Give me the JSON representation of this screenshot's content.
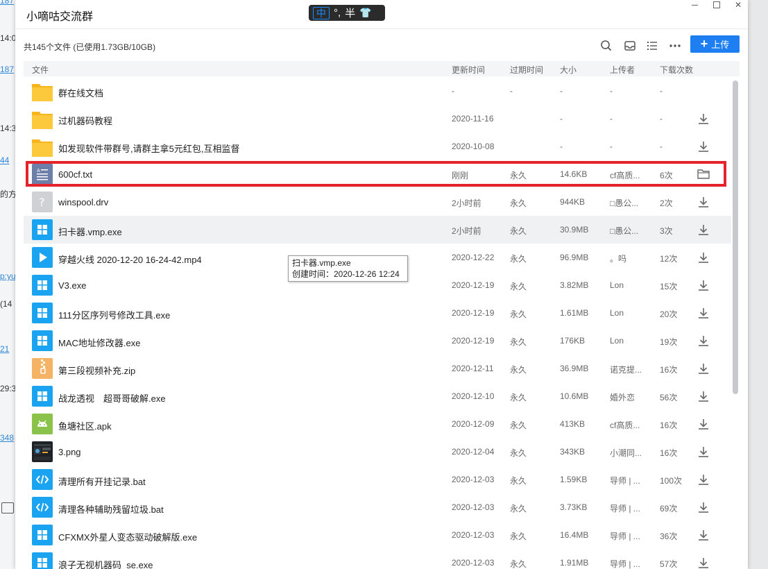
{
  "window": {
    "title": "小嘀咕交流群"
  },
  "ime": {
    "mode": "中",
    "punct": "°,",
    "width": "半"
  },
  "toolbar": {
    "summary": "共145个文件 (已使用1.73GB/10GB)",
    "upload_label": "上传"
  },
  "columns": {
    "name": "文件",
    "updated": "更新时间",
    "expiry": "过期时间",
    "size": "大小",
    "uploader": "上传者",
    "downloads": "下载次数"
  },
  "files": [
    {
      "name": "群在线文档",
      "icon": "folder-icon",
      "date": "-",
      "expiry": "-",
      "size": "-",
      "uploader": "-",
      "downloads": "-",
      "action": ""
    },
    {
      "name": "过机器码教程",
      "icon": "folder-icon",
      "date": "2020-11-16",
      "expiry": "",
      "size": "-",
      "uploader": "-",
      "downloads": "-",
      "action": "download-icon"
    },
    {
      "name": "如发现软件带群号,请群主拿5元红包,互相监督",
      "icon": "folder-icon",
      "date": "2020-10-08",
      "expiry": "",
      "size": "-",
      "uploader": "-",
      "downloads": "-",
      "action": "download-icon"
    },
    {
      "name": "600cf.txt",
      "icon": "text-file-icon",
      "date": "刚刚",
      "expiry": "永久",
      "size": "14.6KB",
      "uploader": "cf高质...",
      "downloads": "6次",
      "action": "open-folder-icon"
    },
    {
      "name": "winspool.drv",
      "icon": "unknown-file-icon",
      "date": "2小时前",
      "expiry": "永久",
      "size": "944KB",
      "uploader": "□愚公...",
      "downloads": "2次",
      "action": "download-icon"
    },
    {
      "name": "扫卡器.vmp.exe",
      "icon": "exe-icon",
      "date": "2小时前",
      "expiry": "永久",
      "size": "30.9MB",
      "uploader": "□愚公...",
      "downloads": "3次",
      "action": "download-icon"
    },
    {
      "name": "穿越火线 2020-12-20 16-24-42.mp4",
      "icon": "video-icon",
      "date": "2020-12-22",
      "expiry": "永久",
      "size": "96.9MB",
      "uploader": "。吗",
      "downloads": "12次",
      "action": "download-icon"
    },
    {
      "name": "V3.exe",
      "icon": "exe-icon",
      "date": "2020-12-19",
      "expiry": "永久",
      "size": "3.82MB",
      "uploader": "Lon",
      "downloads": "15次",
      "action": "download-icon"
    },
    {
      "name": "111分区序列号修改工具.exe",
      "icon": "exe-icon",
      "date": "2020-12-19",
      "expiry": "永久",
      "size": "1.61MB",
      "uploader": "Lon",
      "downloads": "20次",
      "action": "download-icon"
    },
    {
      "name": "MAC地址修改器.exe",
      "icon": "exe-icon",
      "date": "2020-12-19",
      "expiry": "永久",
      "size": "176KB",
      "uploader": "Lon",
      "downloads": "19次",
      "action": "download-icon"
    },
    {
      "name": "第三段视频补充.zip",
      "icon": "zip-icon",
      "date": "2020-12-11",
      "expiry": "永久",
      "size": "36.9MB",
      "uploader": "诺克提...",
      "downloads": "16次",
      "action": "download-icon"
    },
    {
      "name": "战龙透视　超哥哥破解.exe",
      "icon": "exe-icon",
      "date": "2020-12-10",
      "expiry": "永久",
      "size": "10.6MB",
      "uploader": "婚外恋",
      "downloads": "56次",
      "action": "download-icon"
    },
    {
      "name": "鱼塘社区.apk",
      "icon": "apk-icon",
      "date": "2020-12-09",
      "expiry": "永久",
      "size": "413KB",
      "uploader": "cf高质...",
      "downloads": "16次",
      "action": "download-icon"
    },
    {
      "name": "3.png",
      "icon": "image-thumbnail-icon",
      "date": "2020-12-04",
      "expiry": "永久",
      "size": "343KB",
      "uploader": "小潮同...",
      "downloads": "16次",
      "action": "download-icon"
    },
    {
      "name": "清理所有开挂记录.bat",
      "icon": "code-file-icon",
      "date": "2020-12-03",
      "expiry": "永久",
      "size": "1.59KB",
      "uploader": "导师 | ...",
      "downloads": "100次",
      "action": "download-icon"
    },
    {
      "name": "清理各种辅助残留垃圾.bat",
      "icon": "code-file-icon",
      "date": "2020-12-03",
      "expiry": "永久",
      "size": "3.73KB",
      "uploader": "导师 | ...",
      "downloads": "69次",
      "action": "download-icon"
    },
    {
      "name": "CFXMX外星人变态驱动破解版.exe",
      "icon": "exe-icon",
      "date": "2020-12-03",
      "expiry": "永久",
      "size": "16.4MB",
      "uploader": "导师 | ...",
      "downloads": "36次",
      "action": "download-icon"
    },
    {
      "name": "浪子无视机器码_se.exe",
      "icon": "exe-icon",
      "date": "2020-12-03",
      "expiry": "永久",
      "size": "1.91MB",
      "uploader": "导师 | ...",
      "downloads": "57次",
      "action": "download-icon"
    }
  ],
  "tooltip": {
    "name": "扫卡器.vmp.exe",
    "created": "创建时间：2020-12-26 12:24"
  },
  "background": {
    "fragments": [
      "187",
      "14:0",
      "187",
      "14:3",
      "44",
      "的方",
      "p:yu",
      "(14",
      "21",
      "29:3",
      "348"
    ]
  },
  "colors": {
    "accent": "#1d7ff2",
    "selection_outline": "#e5232a",
    "folder": "#fbc73c",
    "exe": "#1aa3f0"
  }
}
